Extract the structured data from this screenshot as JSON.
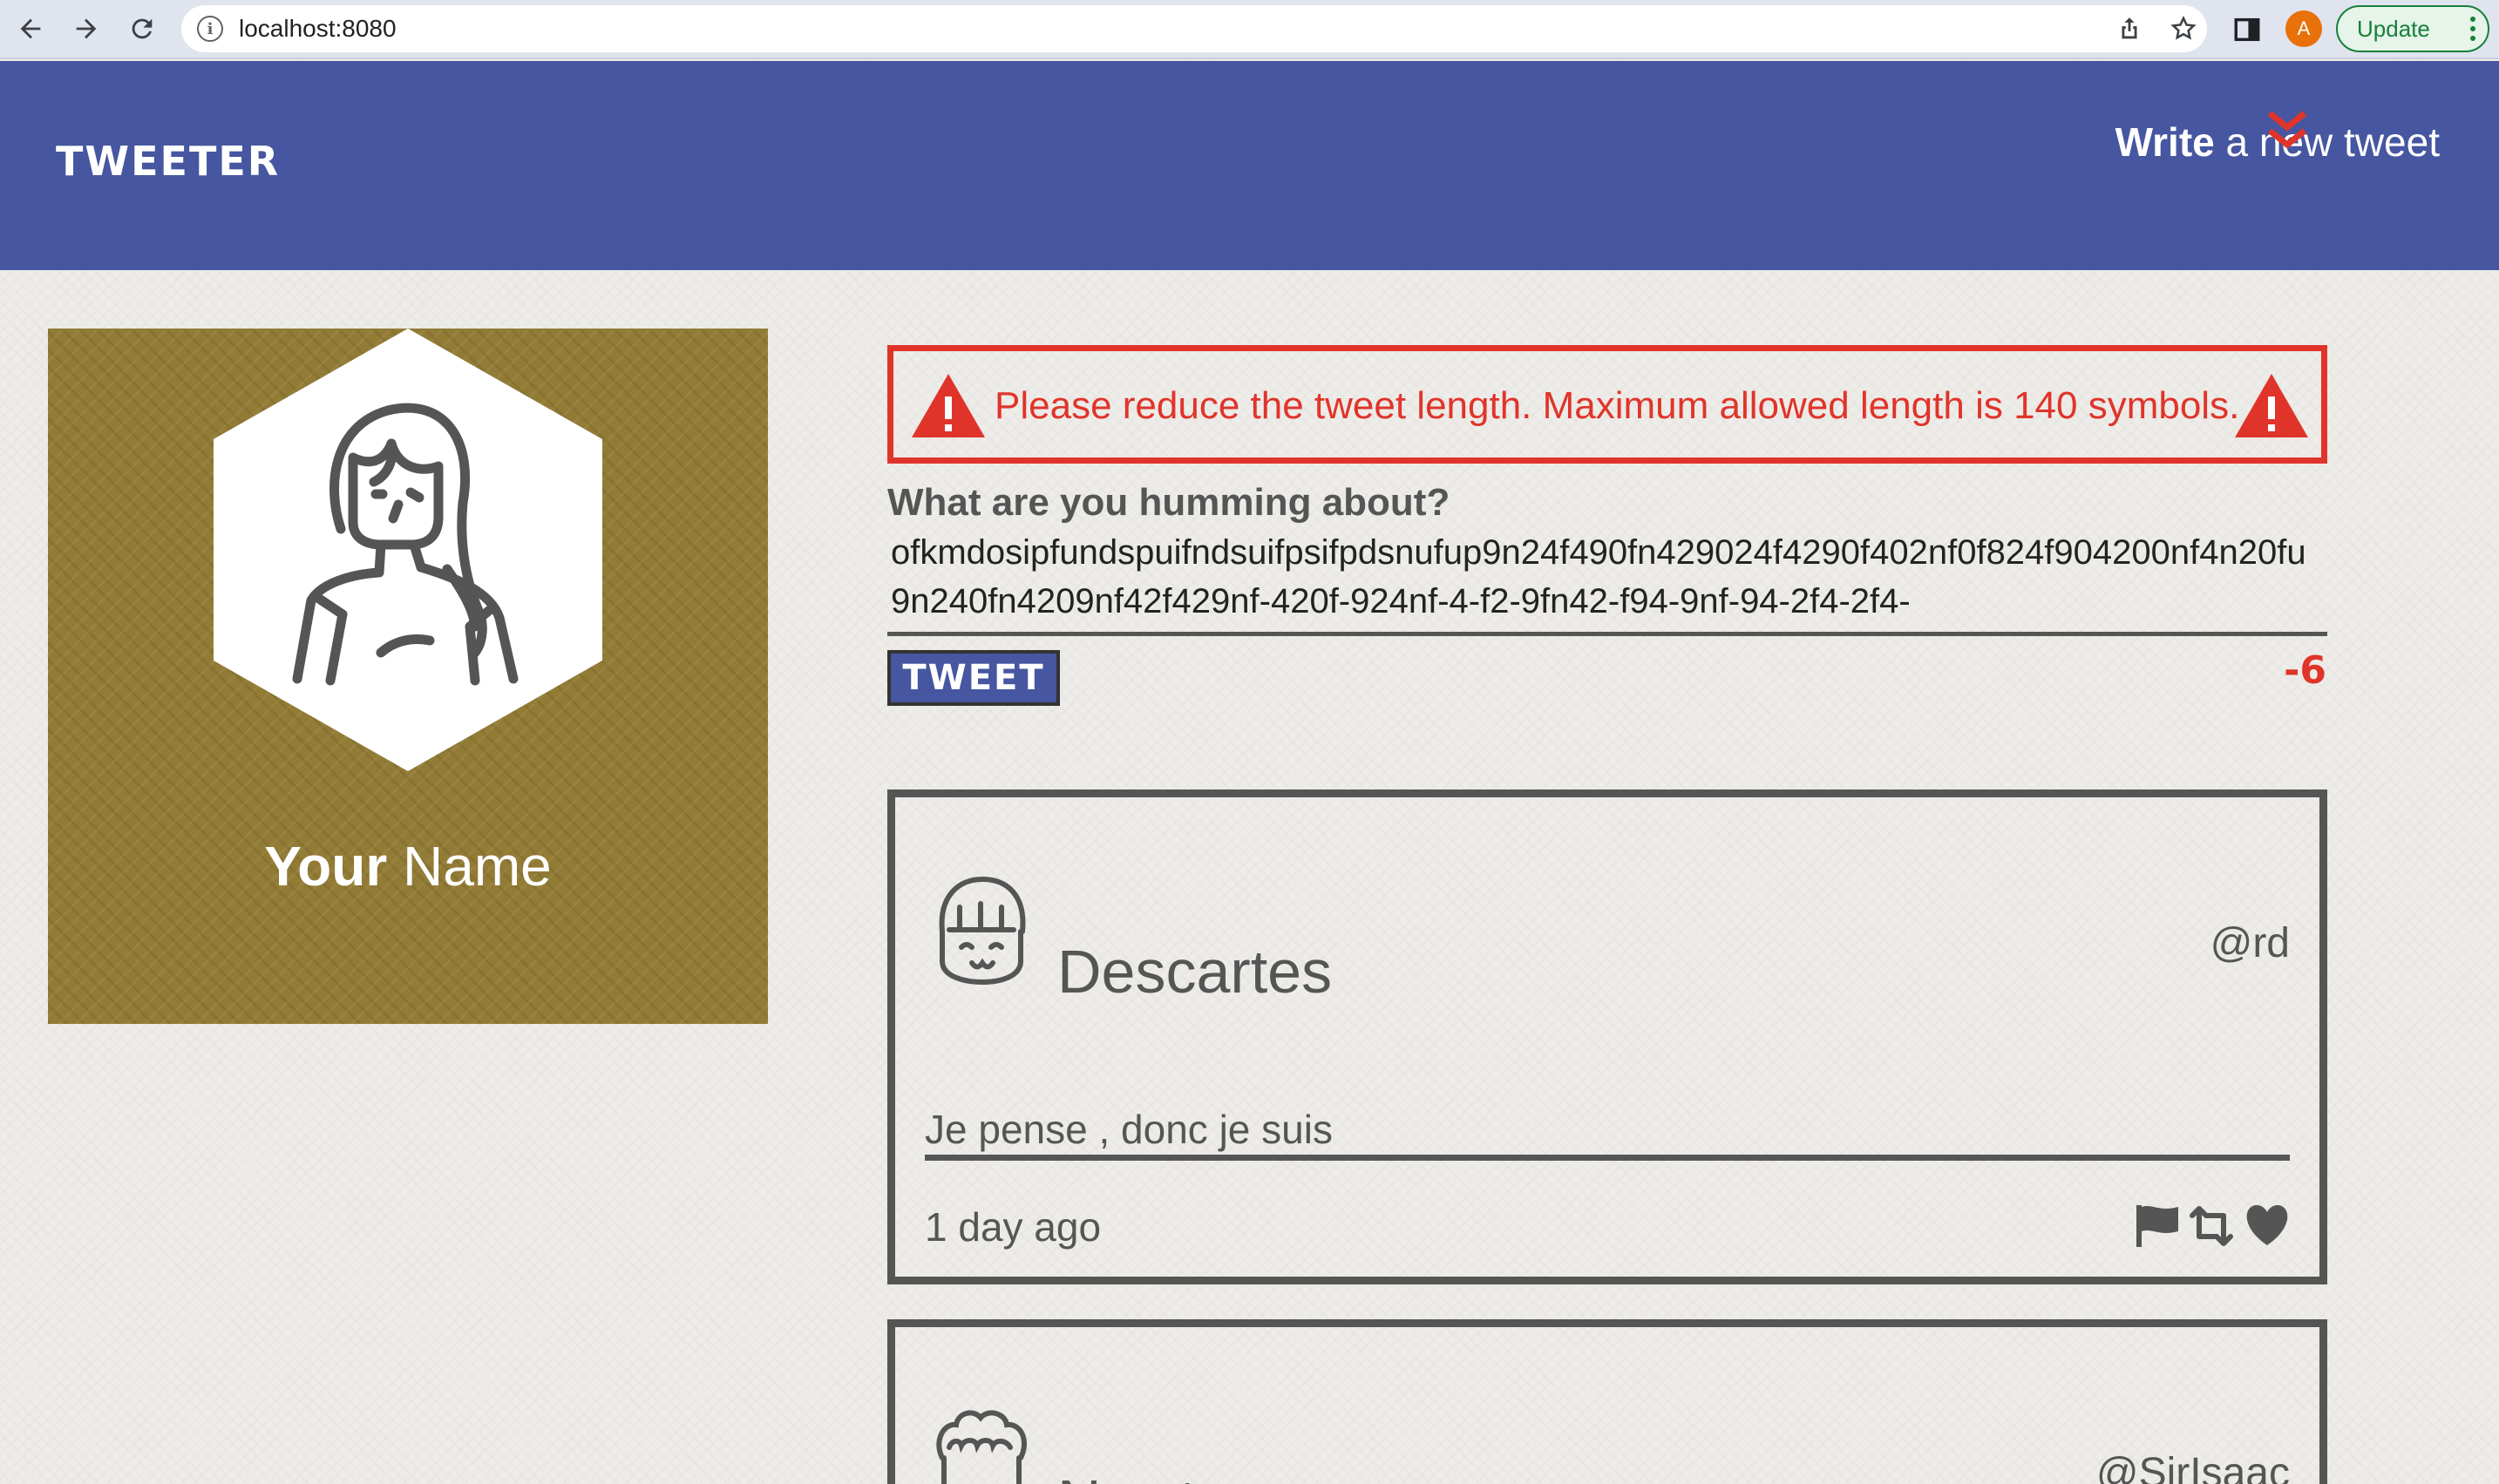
{
  "browser": {
    "url": "localhost:8080",
    "avatar_letter": "A",
    "update_label": "Update"
  },
  "header": {
    "brand": "TWEETER",
    "compose_strong": "Write",
    "compose_rest": " a new tweet"
  },
  "profile": {
    "name_first": "Your",
    "name_last": " Name",
    "background_color": "#927b35"
  },
  "composer": {
    "error_message": "Please reduce the tweet length. Maximum allowed length is 140 symbols.",
    "label": "What are you humming about?",
    "text": "ofkmdosipfundspuifndsuifpsifpdsnufup9n24f490fn429024f4290f402nf0f824f904200nf4n20fu9n240fn4209nf42f429nf-420f-924nf-4-f2-9fn42-f94-9nf-94-2f4-2f4-",
    "button_label": "TWEET",
    "counter": "-6"
  },
  "tweets": [
    {
      "name": "Descartes",
      "handle": "@rd",
      "content": "Je pense , donc je suis",
      "time": "1 day ago"
    },
    {
      "name": "Newton",
      "handle": "@SirIsaac"
    }
  ],
  "colors": {
    "header": "#4656a0",
    "error": "#e0342a",
    "text": "#555555",
    "page_bg": "#eeece8"
  },
  "icons": [
    "back-arrow-icon",
    "forward-arrow-icon",
    "reload-icon",
    "info-icon",
    "share-icon",
    "star-icon",
    "sidebar-icon",
    "double-chevron-down-icon",
    "warning-icon",
    "flag-icon",
    "retweet-icon",
    "heart-icon"
  ]
}
